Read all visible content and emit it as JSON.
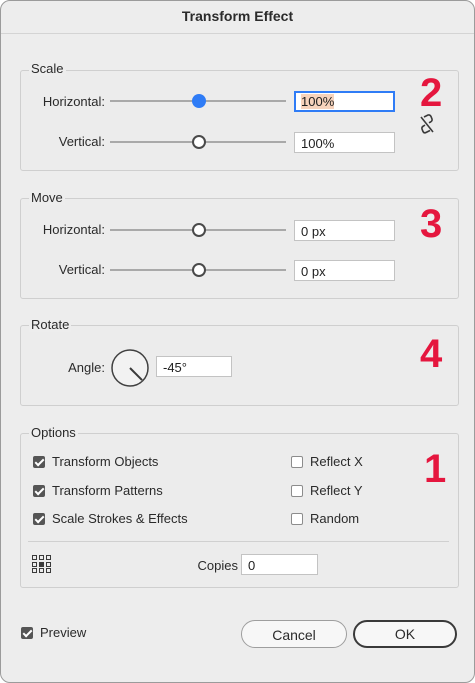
{
  "dialog": {
    "title": "Transform Effect"
  },
  "scale": {
    "legend": "Scale",
    "horizontal": {
      "label": "Horizontal:",
      "value": "100%",
      "slider_level": 0.5
    },
    "vertical": {
      "label": "Vertical:",
      "value": "100%",
      "slider_level": 0.5
    },
    "link_icon": "broken-link-icon"
  },
  "move": {
    "legend": "Move",
    "horizontal": {
      "label": "Horizontal:",
      "value": "0 px",
      "slider_level": 0.5
    },
    "vertical": {
      "label": "Vertical:",
      "value": "0 px",
      "slider_level": 0.5
    }
  },
  "rotate": {
    "legend": "Rotate",
    "angle_label": "Angle:",
    "angle_value": "-45°",
    "angle_degrees": -45
  },
  "options": {
    "legend": "Options",
    "checkboxes": [
      {
        "label": "Transform Objects",
        "checked": true
      },
      {
        "label": "Transform Patterns",
        "checked": true
      },
      {
        "label": "Scale Strokes & Effects",
        "checked": true
      },
      {
        "label": "Reflect X",
        "checked": false
      },
      {
        "label": "Reflect Y",
        "checked": false
      },
      {
        "label": "Random",
        "checked": false
      }
    ],
    "reference_point_icon": "reference-point-grid-icon",
    "copies_label": "Copies",
    "copies_value": "0"
  },
  "footer": {
    "preview_label": "Preview",
    "preview_checked": true,
    "cancel_label": "Cancel",
    "ok_label": "OK"
  },
  "annotations": [
    "2",
    "3",
    "4",
    "1"
  ],
  "colors": {
    "accent": "#2f7cf6",
    "annotation": "#e5163e",
    "selection": "#f7d3bc"
  }
}
